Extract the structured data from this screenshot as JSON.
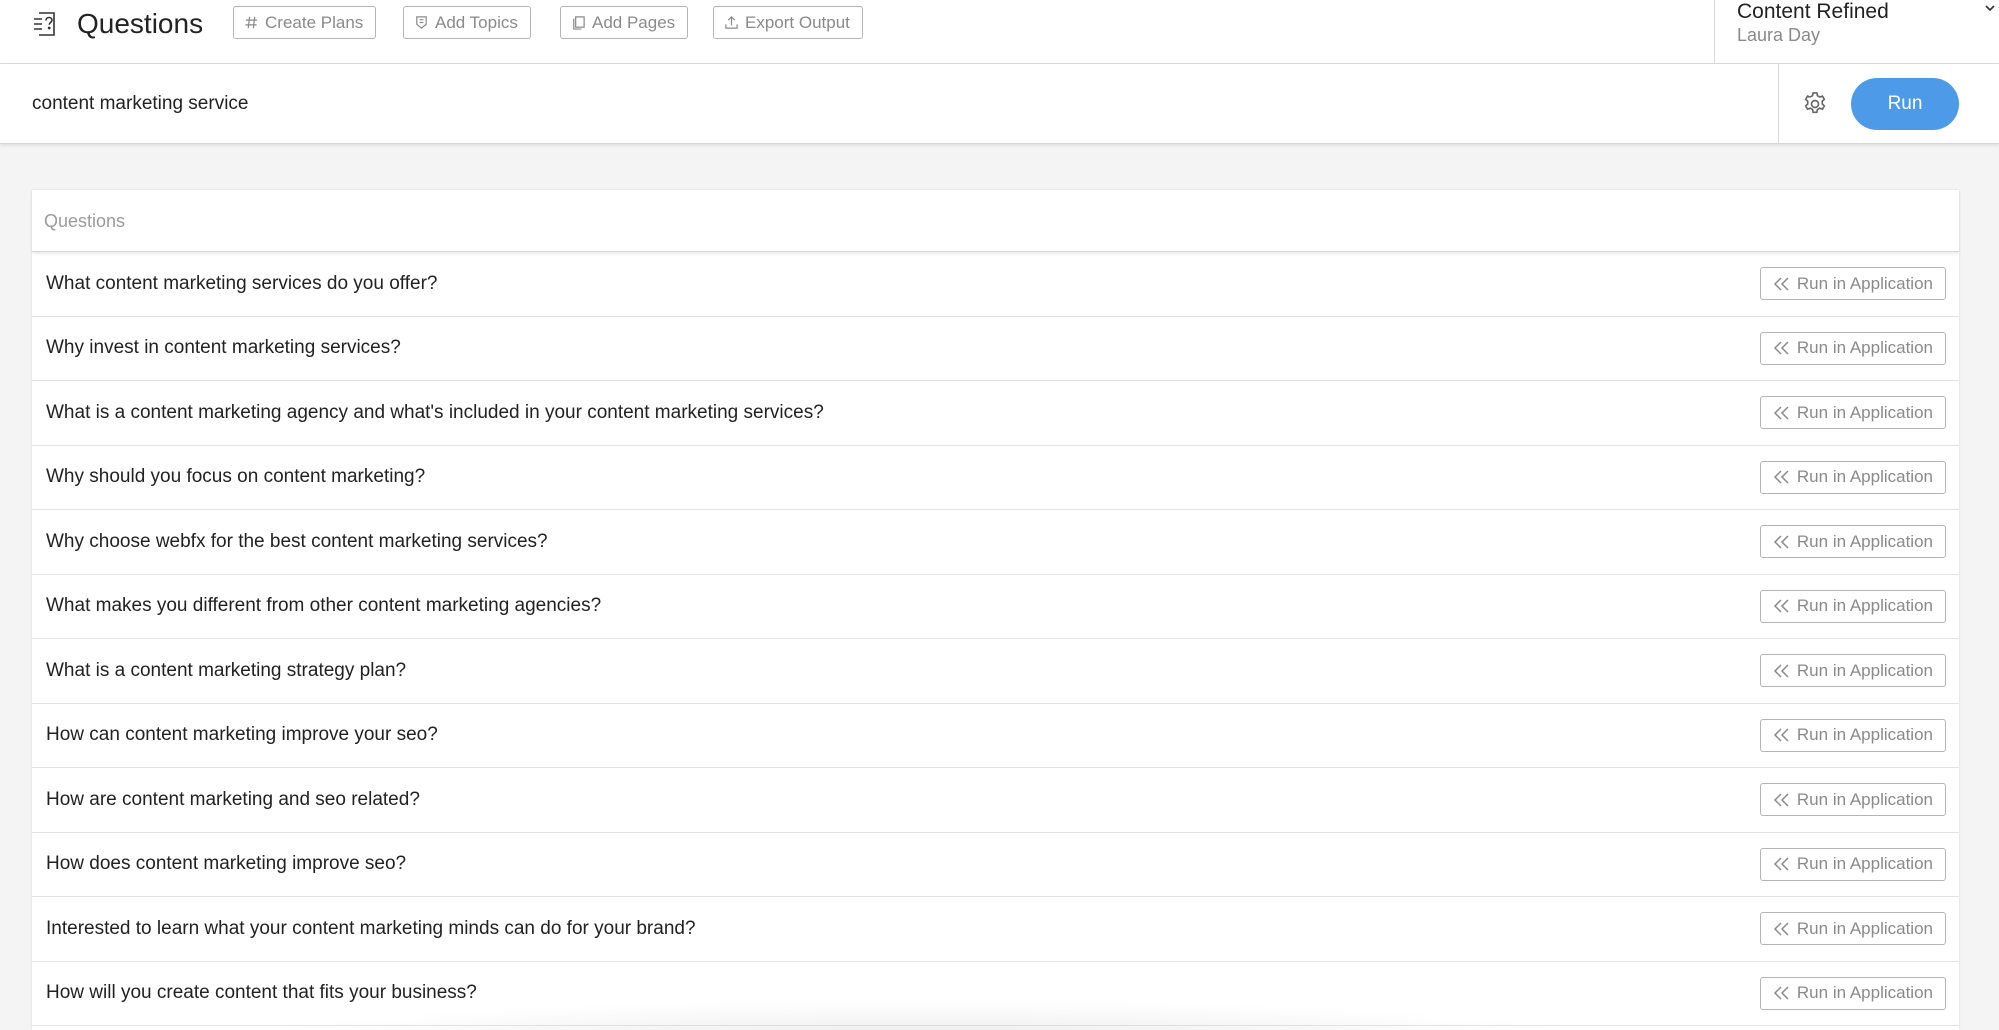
{
  "header": {
    "title": "Questions",
    "tools": [
      {
        "label": "Create Plans",
        "icon": "hash-icon"
      },
      {
        "label": "Add Topics",
        "icon": "topic-icon"
      },
      {
        "label": "Add Pages",
        "icon": "pages-icon"
      },
      {
        "label": "Export Output",
        "icon": "export-icon"
      }
    ],
    "project": {
      "name": "Content Refined",
      "owner": "Laura Day"
    }
  },
  "search": {
    "value": "content marketing service",
    "run_label": "Run"
  },
  "panel": {
    "title": "Questions",
    "action_label": "Run in Application",
    "questions": [
      "What content marketing services do you offer?",
      "Why invest in content marketing services?",
      "What is a content marketing agency and what's included in your content marketing services?",
      "Why should you focus on content marketing?",
      "Why choose webfx for the best content marketing services?",
      "What makes you different from other content marketing agencies?",
      "What is a content marketing strategy plan?",
      "How can content marketing improve your seo?",
      "How are content marketing and seo related?",
      "How does content marketing improve seo?",
      "Interested to learn what your content marketing minds can do for your brand?",
      "How will you create content that fits your business?"
    ]
  },
  "colors": {
    "accent": "#4d9ae8",
    "muted": "#8a8a8a",
    "border": "#b5b5b5"
  }
}
